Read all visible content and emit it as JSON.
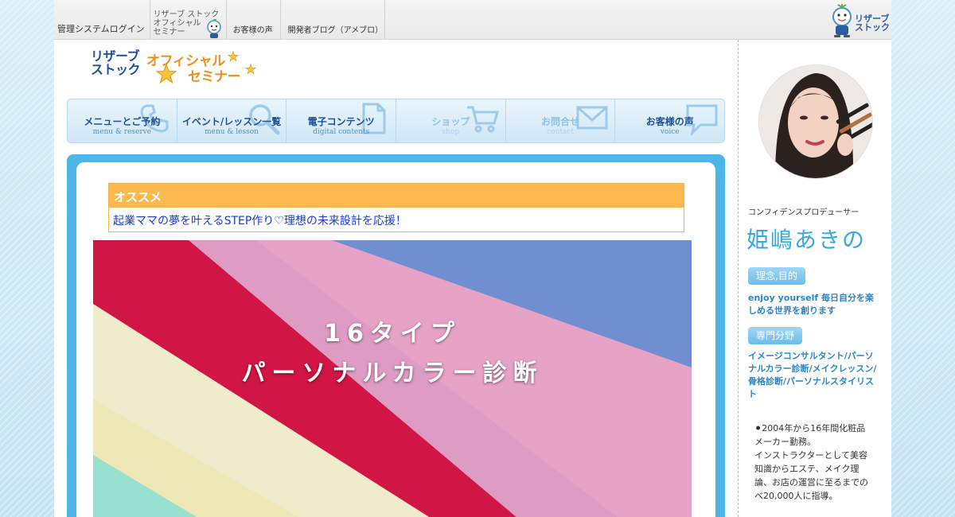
{
  "topnav": {
    "items": [
      {
        "label": "管理システムログイン"
      },
      {
        "line1": "リザーブ ストック",
        "line2": "オフィシャル",
        "line3": "セミナー"
      },
      {
        "label": "お客様の声"
      },
      {
        "label": "開発者ブログ（アメブロ）"
      }
    ]
  },
  "brand_right": {
    "line1": "リザーブ",
    "line2": "ストック"
  },
  "logo": {
    "line1a": "リザーブ",
    "line1b": "ストック",
    "line2a": "オフィシャル",
    "line2b": "セミナー"
  },
  "nav": {
    "tabs": [
      {
        "label": "メニューとご予約",
        "sub": "menu & reserve"
      },
      {
        "label": "イベント/レッスン一覧",
        "sub": "menu & lesson"
      },
      {
        "label": "電子コンテンツ",
        "sub": "digital contents"
      },
      {
        "label": "ショップ",
        "sub": "shop"
      },
      {
        "label": "お問合せ",
        "sub": "contact"
      },
      {
        "label": "お客様の声",
        "sub": "voice"
      }
    ]
  },
  "recommend": {
    "heading": "オススメ",
    "link": "起業ママの夢を叶えるSTEP作り♡理想の未来設計を応援！"
  },
  "hero": {
    "line1": "16タイプ",
    "line2": "パーソナルカラー診断"
  },
  "sidebar": {
    "role": "コンフィデンスプロデューサー",
    "name": "姫嶋あきの",
    "pill1": "理念,目的",
    "philosophy": "enjoy yourself 毎日自分を楽しめる世界を創ります",
    "pill2": "専門分野",
    "specialty": "イメージコンサルタント/パーソナルカラー診断/メイクレッスン/骨格診断/パーソナルスタイリスト",
    "bio": [
      "⚫2004年から16年間化粧品",
      "メーカー勤務。",
      "インストラクターとして美容",
      "知識からエステ、メイク理",
      "論、お店の運営に至るまでの",
      "べ20,000人に指導。"
    ]
  },
  "colors": {
    "accent_blue": "#4db6e9",
    "nav_text": "#1f4f99",
    "recommend_orange": "#fdb84f",
    "link_blue": "#1a3bd1",
    "name_blue": "#38a8e0"
  }
}
